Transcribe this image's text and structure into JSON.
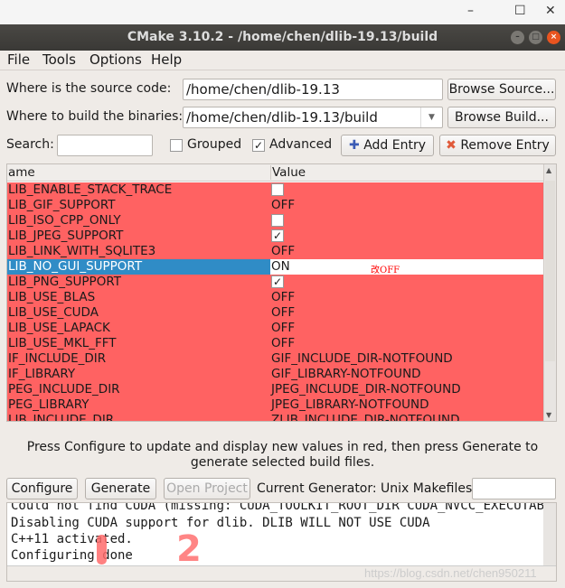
{
  "window": {
    "title": "CMake 3.10.2 - /home/chen/dlib-19.13/build",
    "minimize": "–",
    "maximize": "☐",
    "close": "✕"
  },
  "menu": [
    "File",
    "Tools",
    "Options",
    "Help"
  ],
  "source": {
    "label": "Where is the source code:",
    "value": "/home/chen/dlib-19.13",
    "browse": "Browse Source..."
  },
  "build": {
    "label": "Where to build the binaries:",
    "value": "/home/chen/dlib-19.13/build",
    "browse": "Browse Build..."
  },
  "search": {
    "label": "Search:",
    "value": ""
  },
  "grouped": {
    "label": "Grouped",
    "checked": false
  },
  "advanced": {
    "label": "Advanced",
    "checked": true
  },
  "add_entry": "Add Entry",
  "remove_entry": "Remove Entry",
  "table": {
    "headers": [
      "ame",
      "Value"
    ],
    "rows": [
      {
        "name": "LIB_ENABLE_STACK_TRACE",
        "type": "checkbox",
        "checked": false
      },
      {
        "name": "LIB_GIF_SUPPORT",
        "value": "OFF"
      },
      {
        "name": "LIB_ISO_CPP_ONLY",
        "type": "checkbox",
        "checked": false
      },
      {
        "name": "LIB_JPEG_SUPPORT",
        "type": "checkbox",
        "checked": true
      },
      {
        "name": "LIB_LINK_WITH_SQLITE3",
        "value": "OFF"
      },
      {
        "name": "LIB_NO_GUI_SUPPORT",
        "value": "ON",
        "selected": true
      },
      {
        "name": "LIB_PNG_SUPPORT",
        "type": "checkbox",
        "checked": true
      },
      {
        "name": "LIB_USE_BLAS",
        "value": "OFF"
      },
      {
        "name": "LIB_USE_CUDA",
        "value": "OFF"
      },
      {
        "name": "LIB_USE_LAPACK",
        "value": "OFF"
      },
      {
        "name": "LIB_USE_MKL_FFT",
        "value": "OFF"
      },
      {
        "name": "IF_INCLUDE_DIR",
        "value": "GIF_INCLUDE_DIR-NOTFOUND"
      },
      {
        "name": "IF_LIBRARY",
        "value": "GIF_LIBRARY-NOTFOUND"
      },
      {
        "name": "PEG_INCLUDE_DIR",
        "value": "JPEG_INCLUDE_DIR-NOTFOUND"
      },
      {
        "name": "PEG_LIBRARY",
        "value": "JPEG_LIBRARY-NOTFOUND"
      },
      {
        "name": "LIB_INCLUDE_DIR",
        "value": "ZLIB_INCLUDE_DIR-NOTFOUND"
      }
    ]
  },
  "annotation": {
    "note": "改OFF",
    "mark1": "1",
    "mark2": "2",
    "arrow_color": "#ff0000"
  },
  "hint": "Press Configure to update and display new values in red, then press Generate to generate selected build files.",
  "configure": "Configure",
  "generate": "Generate",
  "open_project": "Open Project",
  "generator": "Current Generator: Unix Makefiles",
  "output": [
    "Could not find CUDA (missing: CUDA_TOOLKIT_ROOT_DIR CUDA_NVCC_EXECUTABLE",
    "Disabling CUDA support for dlib.  DLIB WILL NOT USE CUDA",
    "C++11 activated.",
    "Configuring done"
  ],
  "watermark": "https://blog.csdn.net/chen950211",
  "colors": {
    "changed_row": "#ff6262",
    "selection": "#308cc6"
  }
}
